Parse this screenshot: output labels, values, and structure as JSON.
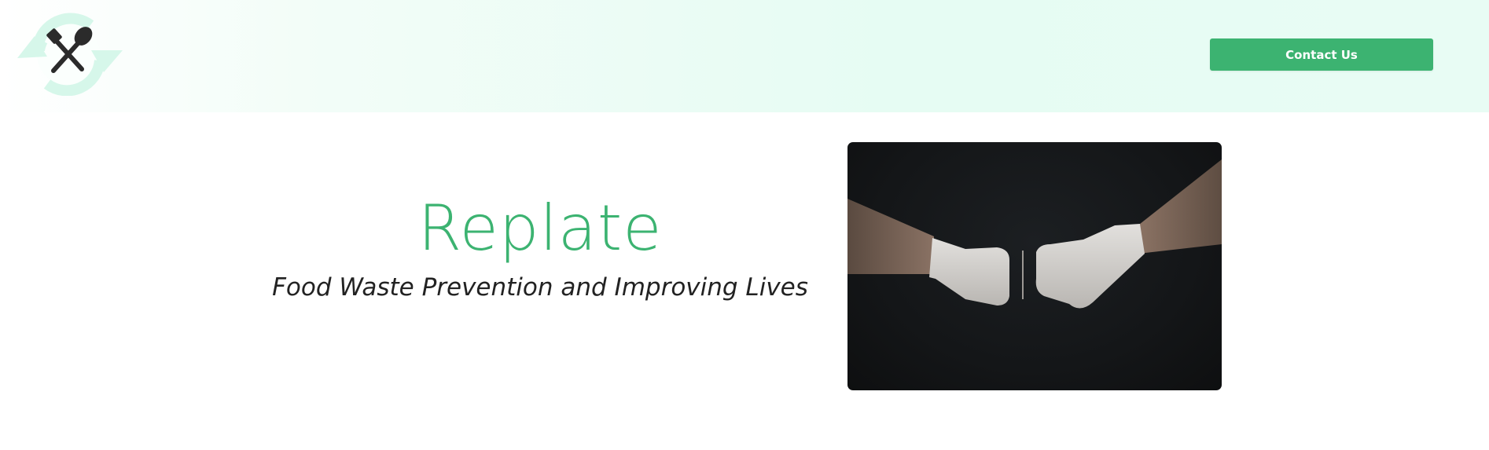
{
  "header": {
    "logo_icon": "fork-spoon-recycle-icon",
    "contact_button_label": "Contact Us"
  },
  "hero": {
    "title": "Replate",
    "subtitle": "Food Waste Prevention and Improving Lives",
    "image_icon": "gloved-fist-bump-photo"
  },
  "colors": {
    "brand_green": "#3cb371",
    "header_mint": "#e6fcf3",
    "logo_ring": "#d6f7ea",
    "subtitle_text": "#222222",
    "photo_background": "#141618"
  }
}
